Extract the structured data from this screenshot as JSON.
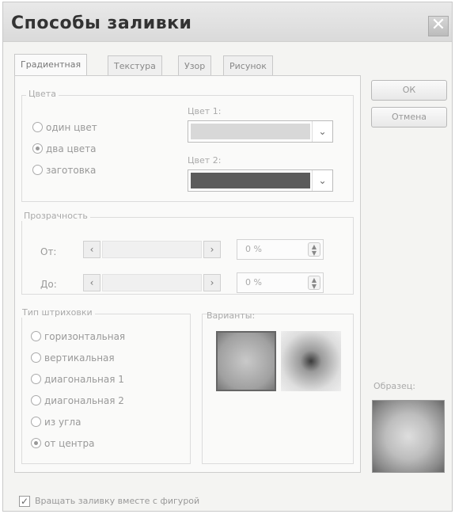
{
  "dialog": {
    "title": "Способы заливки",
    "close_glyph": "✕"
  },
  "tabs": [
    "Градиентная",
    "Текстура",
    "Узор",
    "Рисунок"
  ],
  "colors_group": {
    "title": "Цвета",
    "options": [
      "один цвет",
      "два цвета",
      "заготовка"
    ],
    "selected": "два цвета",
    "color1_label": "Цвет 1:",
    "color2_label": "Цвет 2:",
    "color1_value": "#d8d8d8",
    "color2_value": "#5b5b5b"
  },
  "transparency": {
    "title": "Прозрачность",
    "from_label": "От:",
    "to_label": "До:",
    "from_value": "0 %",
    "to_value": "0 %"
  },
  "hatch_type": {
    "title": "Тип штриховки",
    "options": [
      "горизонтальная",
      "вертикальная",
      "диагональная 1",
      "диагональная 2",
      "из угла",
      "от центра"
    ],
    "selected": "от центра"
  },
  "variants": {
    "title": "Варианты:"
  },
  "buttons": {
    "ok": "ОК",
    "cancel": "Отмена"
  },
  "sample_label": "Образец:",
  "rotate_checkbox": {
    "label": "Вращать заливку вместе с фигурой",
    "checked": true,
    "check_glyph": "✓"
  },
  "glyphs": {
    "chevron": "⌄",
    "left": "‹",
    "right": "›",
    "up": "▲",
    "down": "▼"
  }
}
